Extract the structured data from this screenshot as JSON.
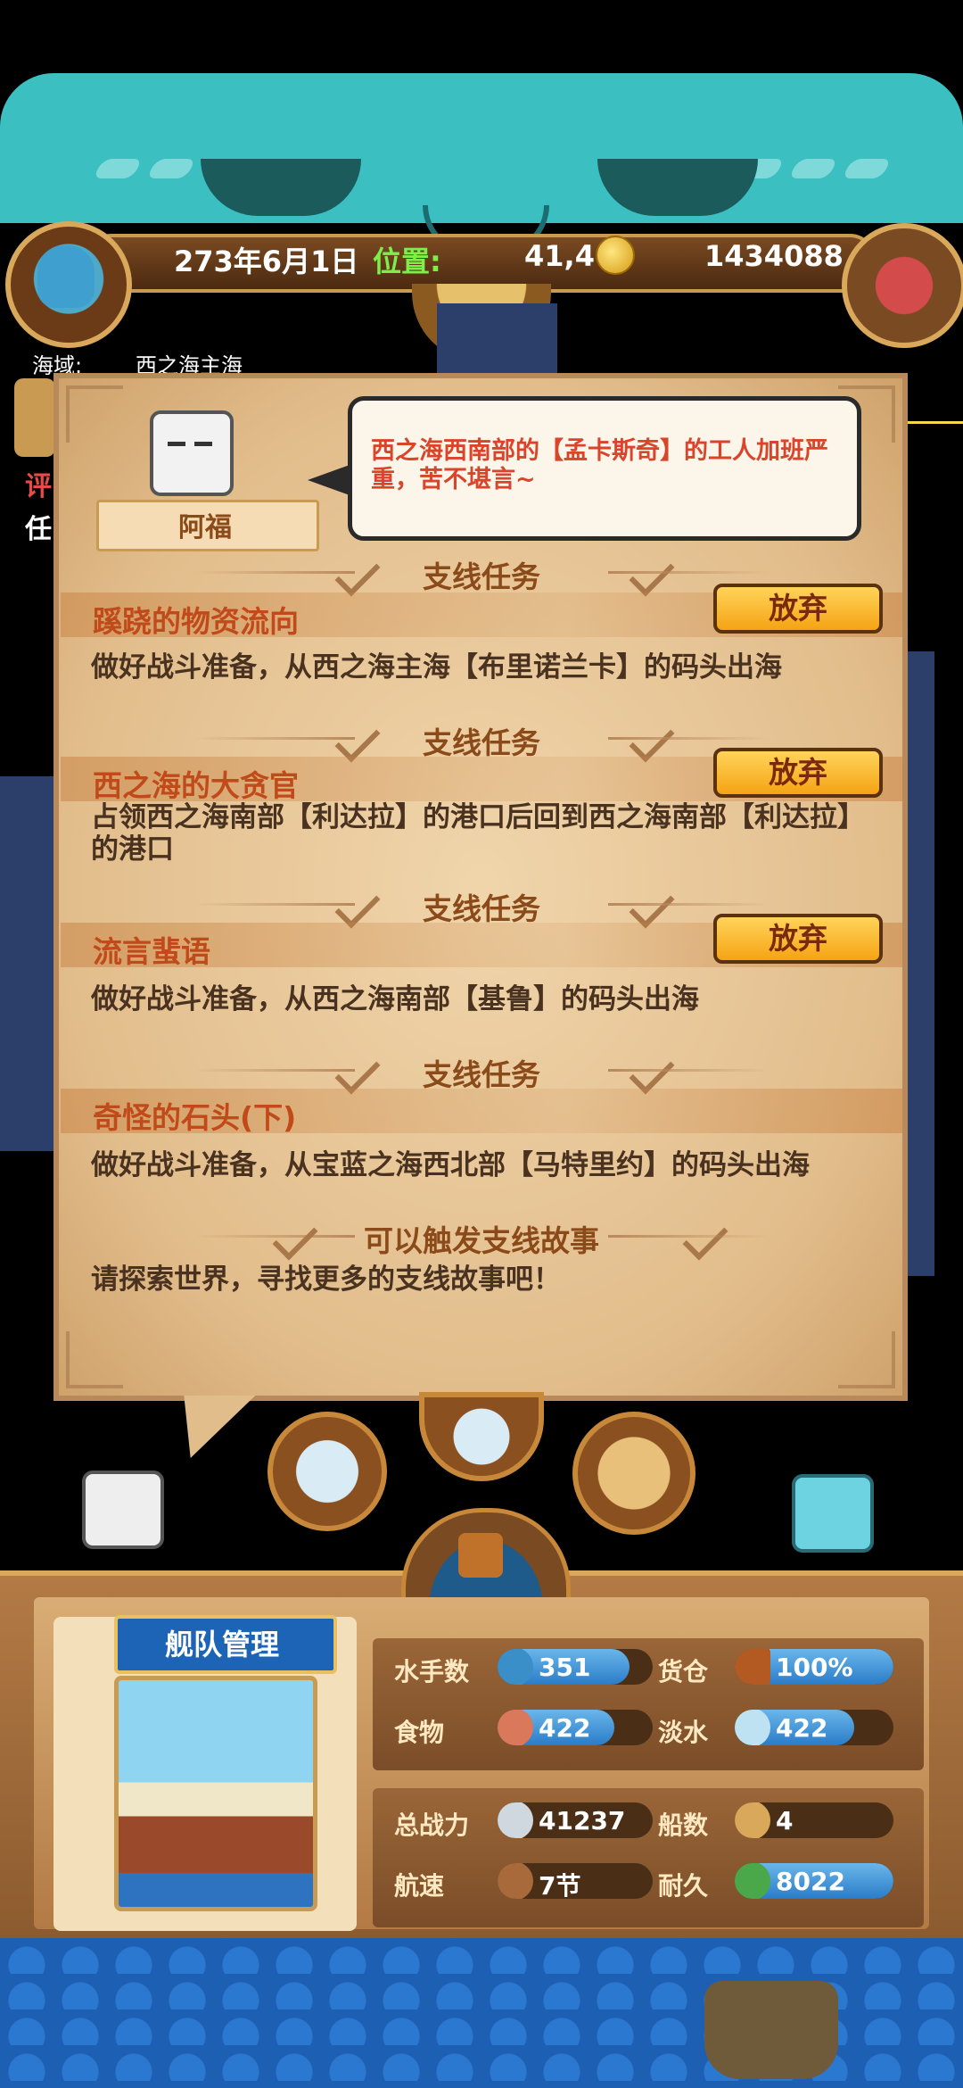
{
  "header": {
    "date": "273年6月1日",
    "position_label": "位置:",
    "position_value": "41,4",
    "gold": "1434088"
  },
  "sea_area": {
    "label": "海域:",
    "value": "西之海主海"
  },
  "left_partial": {
    "line1": "评",
    "line2": "任"
  },
  "npc": {
    "name": "阿福",
    "speech": "西之海西南部的【孟卡斯奇】的工人加班严重，苦不堪言~"
  },
  "quests": [
    {
      "section": "支线任务",
      "title": "蹊跷的物资流向",
      "desc": "做好战斗准备，从西之海主海【布里诺兰卡】的码头出海",
      "button": "放弃"
    },
    {
      "section": "支线任务",
      "title": "西之海的大贪官",
      "desc": "占领西之海南部【利达拉】的港口后回到西之海南部【利达拉】的港口",
      "button": "放弃"
    },
    {
      "section": "支线任务",
      "title": "流言蜚语",
      "desc": "做好战斗准备，从西之海南部【基鲁】的码头出海",
      "button": "放弃"
    },
    {
      "section": "支线任务",
      "title": "奇怪的石头(下)",
      "desc": "做好战斗准备，从宝蓝之海西北部【马特里约】的码头出海"
    }
  ],
  "story": {
    "section": "可以触发支线故事",
    "desc": "请探索世界，寻找更多的支线故事吧！"
  },
  "fleet": {
    "title": "舰队管理",
    "stats": [
      {
        "label": "水手数",
        "value": "351",
        "icon": "sailor-icon",
        "fill": 0.85
      },
      {
        "label": "货仓",
        "value": "100%",
        "icon": "cargo-icon",
        "fill": 1.0
      },
      {
        "label": "食物",
        "value": "422",
        "icon": "meat-icon",
        "fill": 0.75
      },
      {
        "label": "淡水",
        "value": "422",
        "icon": "water-icon",
        "fill": 0.75
      },
      {
        "label": "总战力",
        "value": "41237",
        "icon": "sword-icon",
        "fill": 0
      },
      {
        "label": "船数",
        "value": "4",
        "icon": "ship-count-icon",
        "fill": 0
      },
      {
        "label": "航速",
        "value": "7节",
        "icon": "sail-icon",
        "fill": 0
      },
      {
        "label": "耐久",
        "value": "8022",
        "icon": "durability-icon",
        "fill": 1.0
      }
    ]
  },
  "colors": {
    "parchment": "#e9caa0",
    "title_red": "#c14a1a",
    "button_gold": "#f5a414",
    "cat_teal": "#3bbfc0",
    "stat_blue": "#2a7cc8"
  }
}
